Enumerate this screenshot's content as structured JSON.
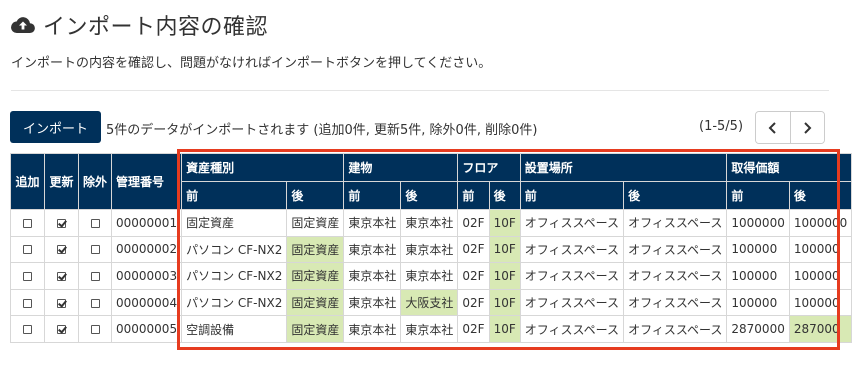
{
  "header": {
    "title": "インポート内容の確認",
    "icon": "cloud-upload-icon",
    "subtitle": "インポートの内容を確認し、問題がなければインポートボタンを押してください。"
  },
  "toolbar": {
    "import_label": "インポート",
    "summary": "5件のデータがインポートされます (追加0件, 更新5件, 除外0件, 削除0件)",
    "page_count": "(1-5/5)"
  },
  "colors": {
    "header_bg": "#00305a",
    "changed_bg": "#d8e9b4",
    "highlight": "#e63b1f"
  },
  "table": {
    "headers": {
      "add": "追加",
      "update": "更新",
      "exclude": "除外",
      "code": "管理番号",
      "type": "資産種別",
      "building": "建物",
      "floor": "フロア",
      "place": "設置場所",
      "price": "取得価額",
      "before": "前",
      "after": "後"
    },
    "rows": [
      {
        "add": false,
        "update": true,
        "exclude": false,
        "code": "00000001",
        "type_b": "固定資産",
        "type_a": "固定資産",
        "bldg_b": "東京本社",
        "bldg_a": "東京本社",
        "floor_b": "02F",
        "floor_a": "10F",
        "place_b": "オフィススペース",
        "place_a": "オフィススペース",
        "price_b": "1000000",
        "price_a": "1000000"
      },
      {
        "add": false,
        "update": true,
        "exclude": false,
        "code": "00000002",
        "type_b": "パソコン CF-NX2",
        "type_a": "固定資産",
        "bldg_b": "東京本社",
        "bldg_a": "東京本社",
        "floor_b": "02F",
        "floor_a": "10F",
        "place_b": "オフィススペース",
        "place_a": "オフィススペース",
        "price_b": "100000",
        "price_a": "100000"
      },
      {
        "add": false,
        "update": true,
        "exclude": false,
        "code": "00000003",
        "type_b": "パソコン CF-NX2",
        "type_a": "固定資産",
        "bldg_b": "東京本社",
        "bldg_a": "東京本社",
        "floor_b": "02F",
        "floor_a": "10F",
        "place_b": "オフィススペース",
        "place_a": "オフィススペース",
        "price_b": "100000",
        "price_a": "100000"
      },
      {
        "add": false,
        "update": true,
        "exclude": false,
        "code": "00000004",
        "type_b": "パソコン CF-NX2",
        "type_a": "固定資産",
        "bldg_b": "東京本社",
        "bldg_a": "大阪支社",
        "floor_b": "02F",
        "floor_a": "10F",
        "place_b": "オフィススペース",
        "place_a": "オフィススペース",
        "price_b": "100000",
        "price_a": "100000"
      },
      {
        "add": false,
        "update": true,
        "exclude": false,
        "code": "00000005",
        "type_b": "空調設備",
        "type_a": "固定資産",
        "bldg_b": "東京本社",
        "bldg_a": "東京本社",
        "floor_b": "02F",
        "floor_a": "10F",
        "place_b": "オフィススペース",
        "place_a": "オフィススペース",
        "price_b": "2870000",
        "price_a": "287000"
      }
    ]
  }
}
